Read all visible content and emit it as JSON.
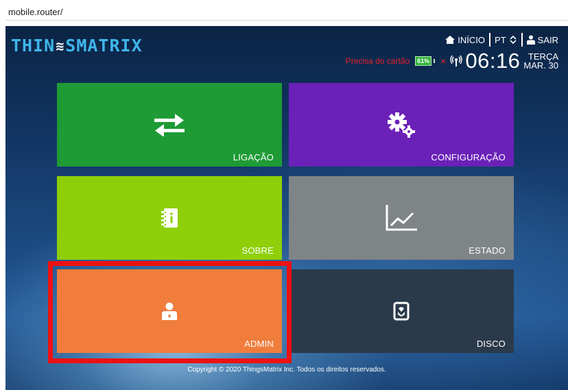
{
  "browser": {
    "url": "mobile.router/"
  },
  "header": {
    "logo_text_left": "THIN",
    "logo_mark": "≋",
    "logo_text_right": "SMATRIX",
    "nav": {
      "home_label": "INÍCIO",
      "language_label": "PT",
      "logout_label": "SAIR"
    },
    "status": {
      "card_warning": "Precisa do cartão",
      "battery_percent": "61%",
      "no_sim": "×",
      "time": "06:16",
      "weekday": "TERÇA",
      "date": "MAR. 30"
    }
  },
  "tiles": [
    {
      "label": "LIGAÇÃO",
      "icon": "transfer-arrows-icon",
      "color": "#1e9b35"
    },
    {
      "label": "CONFIGURAÇÃO",
      "icon": "gears-icon",
      "color": "#6b21b8"
    },
    {
      "label": "SOBRE",
      "icon": "info-notebook-icon",
      "color": "#8fcf0a"
    },
    {
      "label": "ESTADO",
      "icon": "line-chart-icon",
      "color": "#7f8487"
    },
    {
      "label": "ADMIN",
      "icon": "admin-user-icon",
      "color": "#f07d3c"
    },
    {
      "label": "DISCO",
      "icon": "sd-card-icon",
      "color": "#2b3a4b"
    }
  ],
  "footer": {
    "copyright": "Copyright © 2020 ThingsMatrix Inc. Todos os direitos reservados."
  },
  "colors": {
    "logo": "#3fb6ea",
    "warning": "#e8202a",
    "highlight": "#ee1111"
  }
}
